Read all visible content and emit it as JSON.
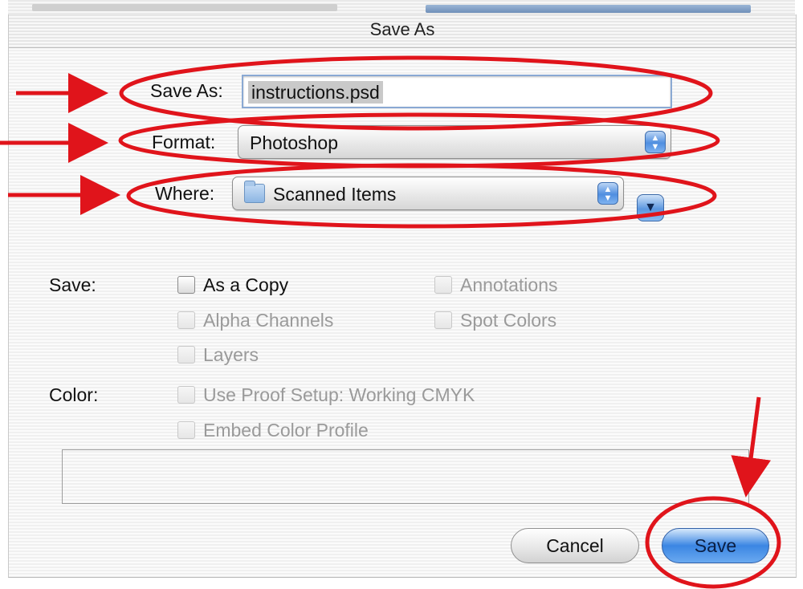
{
  "dialog": {
    "title": "Save As"
  },
  "fields": {
    "save_as_label": "Save As:",
    "filename": "instructions.psd",
    "format_label": "Format:",
    "format_value": "Photoshop",
    "where_label": "Where:",
    "where_value": "Scanned Items"
  },
  "options": {
    "save_label": "Save:",
    "as_a_copy": "As a Copy",
    "annotations": "Annotations",
    "alpha_channels": "Alpha Channels",
    "spot_colors": "Spot Colors",
    "layers": "Layers",
    "color_label": "Color:",
    "use_proof_setup": "Use Proof Setup:  Working CMYK",
    "embed_color_profile": "Embed Color Profile"
  },
  "buttons": {
    "cancel": "Cancel",
    "save": "Save"
  },
  "icons": {
    "stepper": "up-down-stepper-icon",
    "folder": "folder-icon",
    "expand": "chevron-down-icon"
  },
  "colors": {
    "annotation_red": "#e0141b",
    "aqua_blue": "#3b86e3"
  }
}
